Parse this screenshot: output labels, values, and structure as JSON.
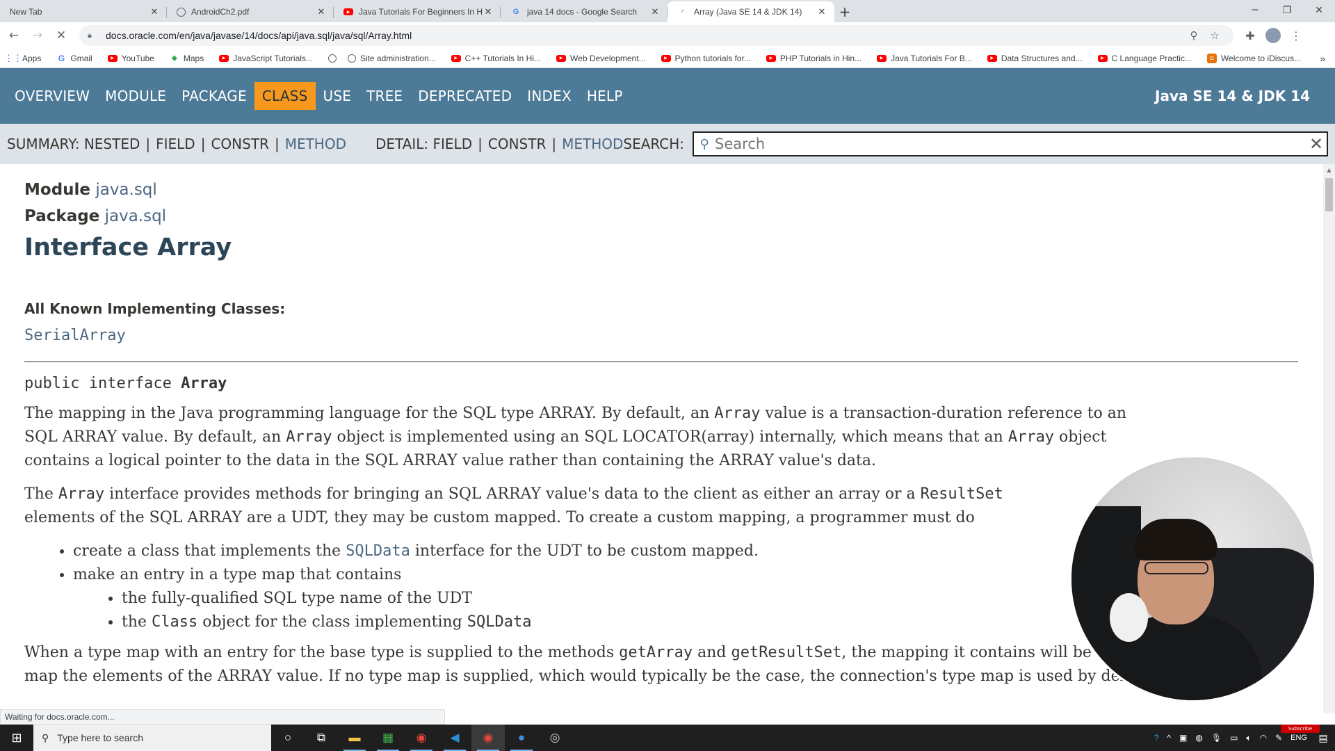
{
  "browser": {
    "tabs": [
      {
        "title": "New Tab",
        "icon": "none",
        "active": false
      },
      {
        "title": "AndroidCh2.pdf",
        "icon": "globe-icon",
        "active": false
      },
      {
        "title": "Java Tutorials For Beginners In Hi",
        "icon": "youtube-icon",
        "active": false
      },
      {
        "title": "java 14 docs - Google Search",
        "icon": "google-icon",
        "active": false
      },
      {
        "title": "Array (Java SE 14 & JDK 14)",
        "icon": "loading-icon",
        "active": true
      }
    ],
    "url": "docs.oracle.com/en/java/javase/14/docs/api/java.sql/java/sql/Array.html",
    "bookmarks": [
      {
        "label": "Apps",
        "icon": "apps-grid-icon"
      },
      {
        "label": "Gmail",
        "icon": "google-icon"
      },
      {
        "label": "YouTube",
        "icon": "youtube-icon"
      },
      {
        "label": "Maps",
        "icon": "maps-icon"
      },
      {
        "label": "JavaScript Tutorials...",
        "icon": "youtube-icon"
      },
      {
        "label": "",
        "icon": "globe-icon"
      },
      {
        "label": "Site administration...",
        "icon": "globe-icon"
      },
      {
        "label": "C++ Tutorials In Hi...",
        "icon": "youtube-icon"
      },
      {
        "label": "Web Development...",
        "icon": "youtube-icon"
      },
      {
        "label": "Python tutorials for...",
        "icon": "youtube-icon"
      },
      {
        "label": "PHP Tutorials in Hin...",
        "icon": "youtube-icon"
      },
      {
        "label": "Java Tutorials For B...",
        "icon": "youtube-icon"
      },
      {
        "label": "Data Structures and...",
        "icon": "youtube-icon"
      },
      {
        "label": "C Language Practic...",
        "icon": "youtube-icon"
      },
      {
        "label": "Welcome to iDiscus...",
        "icon": "discuss-icon"
      }
    ],
    "status_text": "Waiting for docs.oracle.com..."
  },
  "javadoc": {
    "topnav": [
      {
        "label": "OVERVIEW",
        "current": false
      },
      {
        "label": "MODULE",
        "current": false
      },
      {
        "label": "PACKAGE",
        "current": false
      },
      {
        "label": "CLASS",
        "current": true
      },
      {
        "label": "USE",
        "current": false
      },
      {
        "label": "TREE",
        "current": false
      },
      {
        "label": "DEPRECATED",
        "current": false
      },
      {
        "label": "INDEX",
        "current": false
      },
      {
        "label": "HELP",
        "current": false
      }
    ],
    "brand": "Java SE 14 & JDK 14",
    "subnav": {
      "summary_label": "SUMMARY:",
      "summary_nested": "NESTED",
      "summary_field": "FIELD",
      "summary_constr": "CONSTR",
      "summary_method": "METHOD",
      "detail_label": "DETAIL:",
      "detail_field": "FIELD",
      "detail_constr": "CONSTR",
      "detail_method": "METHOD",
      "separator": "|",
      "search_label": "SEARCH:",
      "search_placeholder": "Search"
    },
    "module_label": "Module",
    "module_name": "java.sql",
    "package_label": "Package",
    "package_name": "java.sql",
    "title": "Interface Array",
    "impl_heading": "All Known Implementing Classes:",
    "impl_class": "SerialArray",
    "signature_prefix": "public interface ",
    "signature_name": "Array",
    "p1": {
      "l1a": "The mapping in the Java programming language for the SQL type ARRAY. By default, an ",
      "l1b": "Array",
      "l1c": " value is a transaction-duration reference to an",
      "l2a": "SQL ARRAY value. By default, an ",
      "l2b": "Array",
      "l2c": " object is implemented using an SQL LOCATOR(array) internally, which means that an ",
      "l2d": "Array",
      "l2e": " object",
      "l3": "contains a logical pointer to the data in the SQL ARRAY value rather than containing the ARRAY value's data."
    },
    "p2": {
      "l1a": "The ",
      "l1b": "Array",
      "l1c": " interface provides methods for bringing an SQL ARRAY value's data to the client as either an array or a ",
      "l1d": "ResultSet",
      "l2": "elements of the SQL ARRAY are a UDT, they may be custom mapped. To create a custom mapping, a programmer must do"
    },
    "bullets": {
      "b1a": "create a class that implements the ",
      "b1b": "SQLData",
      "b1c": " interface for the UDT to be custom mapped.",
      "b2": "make an entry in a type map that contains",
      "b2s1": "the fully-qualified SQL type name of the UDT",
      "b2s2a": "the ",
      "b2s2b": "Class",
      "b2s2c": " object for the class implementing ",
      "b2s2d": "SQLData"
    },
    "p3": {
      "l1a": "When a type map with an entry for the base type is supplied to the methods ",
      "l1b": "getArray",
      "l1c": " and ",
      "l1d": "getResultSet",
      "l1e": ", the mapping it contains will be used to",
      "l2": "map the elements of the ARRAY value. If no type map is supplied, which would typically be the case, the connection's type map is used by default."
    }
  },
  "taskbar": {
    "search_placeholder": "Type here to search",
    "language": "ENG",
    "subscribe_badge": "Subscribe"
  },
  "colors": {
    "nav_bg": "#4d7a97",
    "nav_current": "#f8981d",
    "subnav_bg": "#dee3e9",
    "link": "#4a6782",
    "title": "#2c4557"
  }
}
